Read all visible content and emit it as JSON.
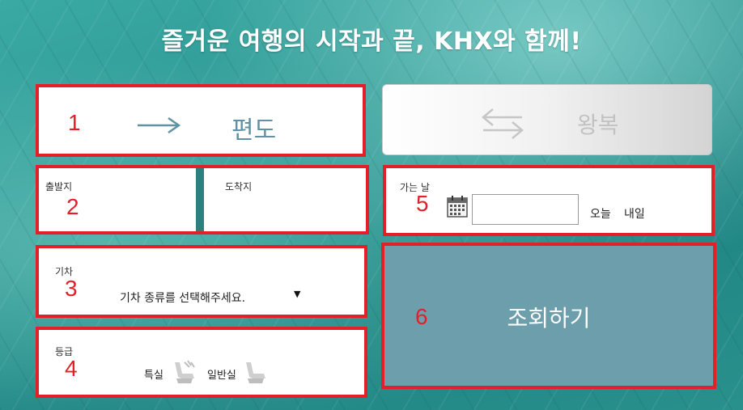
{
  "headline": "즐거운 여행의 시작과 끝, KHX와 함께!",
  "trip_type": {
    "oneway": {
      "number": "1",
      "label": "편도",
      "icon": "arrow-right-icon"
    },
    "roundtrip": {
      "label": "왕복",
      "icon": "swap-arrows-icon"
    }
  },
  "stations": {
    "number": "2",
    "departure_label": "출발지",
    "arrival_label": "도착지",
    "departure_value": "",
    "arrival_value": ""
  },
  "date": {
    "number": "5",
    "label": "가는 날",
    "value": "",
    "icon": "calendar-icon",
    "today": "오늘",
    "tomorrow": "내일"
  },
  "train": {
    "number": "3",
    "label": "기차",
    "selected": "기차 종류를 선택해주세요."
  },
  "seat_class": {
    "number": "4",
    "label": "등급",
    "special": "특실",
    "general": "일반실",
    "icon": "seat-icon"
  },
  "search": {
    "number": "6",
    "label": "조회하기"
  },
  "colors": {
    "accent_red": "#e3202a",
    "search_bg": "#6c9eab",
    "teal_text": "#5f93a1"
  }
}
